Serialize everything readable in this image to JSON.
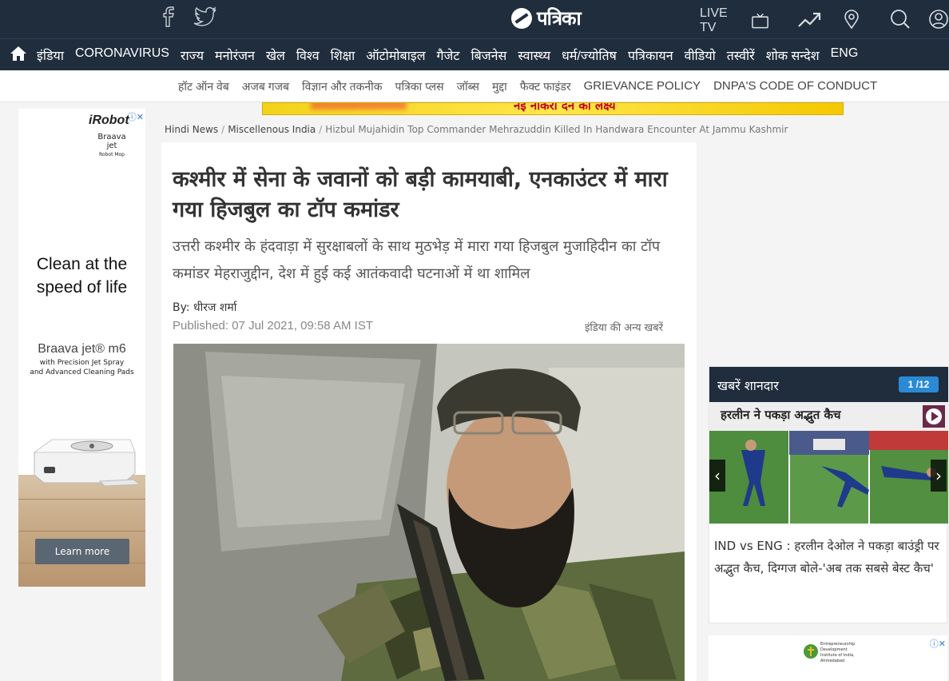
{
  "header": {
    "brand": "पत्रिका",
    "live_tv": "LIVE TV"
  },
  "main_nav": [
    "इंडिया",
    "CORONAVIRUS",
    "राज्य",
    "मनोरंजन",
    "खेल",
    "विश्व",
    "शिक्षा",
    "ऑटोमोबाइल",
    "गैजेट",
    "बिजनेस",
    "स्वास्थ्य",
    "धर्म/ज्योतिष",
    "पत्रिकायन",
    "वीडियो",
    "तस्वीरें",
    "शोक सन्देश",
    "ENG"
  ],
  "sub_nav": [
    "हॉट ऑन वेब",
    "अजब गजब",
    "विज्ञान और तकनीक",
    "पत्रिका प्लस",
    "जॉब्स",
    "मुद्दा",
    "फैक्ट फाइंडर",
    "GRIEVANCE POLICY",
    "DNPA'S CODE OF CONDUCT"
  ],
  "top_banner": {
    "text": "नई नौकरी देने का लक्ष्य"
  },
  "left_ad": {
    "brand": "iRobot",
    "product_small": "Braava jet",
    "product_small_sub": "Robot Mop",
    "headline_line1": "Clean at the",
    "headline_line2": "speed of life",
    "product_name": "Braava jet® m6",
    "product_sub_line1": "with Precision Jet Spray",
    "product_sub_line2": "and Advanced Cleaning Pads",
    "cta": "Learn more"
  },
  "breadcrumb": {
    "items": [
      "Hindi News",
      "Miscellenous India"
    ],
    "current": "Hizbul Mujahidin Top Commander Mehrazuddin Killed In Handwara Encounter At Jammu Kashmir"
  },
  "article": {
    "headline": "कश्मीर में सेना के जवानों को बड़ी कामयाबी, एनकाउंटर में मारा गया हिजबुल का टॉप कमांडर",
    "summary": "उत्तरी कश्मीर के हंदवाड़ा में सुरक्षाबलों के साथ मुठभेड़ में मारा गया हिजबुल मुजाहिदीन का टॉप कमांडर मेहराजुद्दीन, देश में हुई कई आतंकवादी घटनाओं में था शामिल",
    "byline": "By: धीरज शर्मा",
    "published": "Published: 07 Jul 2021, 09:58 AM IST",
    "more_link": "इंडिया की अन्य खबरें"
  },
  "widget": {
    "title": "खबरें शानदार",
    "counter": "1 /12",
    "slide_banner": "हरलीन ने पकड़ा अद्भुत कैच",
    "caption": "IND vs ENG : हरलीन देओल ने पकड़ा बाउंड्री पर अद्भुत कैच, दिग्गज बोले-'अब तक सबसे बेस्ट कैच'"
  },
  "bottom_ad": {
    "line1": "Entrepreneurship",
    "line2": "Development",
    "line3": "Institute of India,",
    "line4": "Ahmedabad"
  },
  "colors": {
    "nav_bg": "#1f2d3d",
    "accent_blue": "#2a8ad6",
    "ad_button": "#5b6673"
  }
}
